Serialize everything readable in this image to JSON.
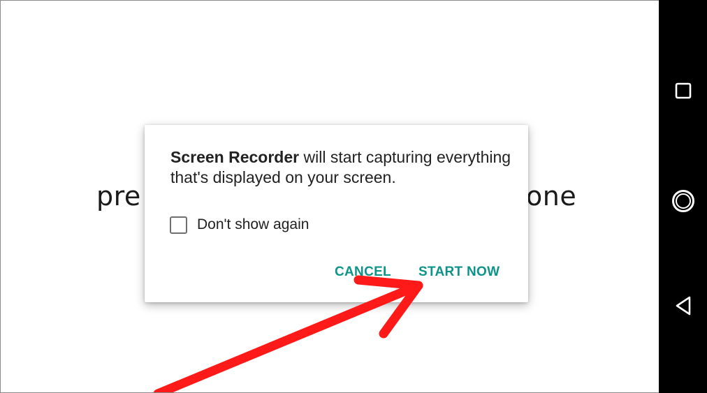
{
  "background": {
    "text_left": "pre",
    "text_right": "one"
  },
  "dialog": {
    "app_name": "Screen Recorder",
    "message_rest": " will start capturing everything that's displayed on your screen.",
    "checkbox_label": "Don't show again",
    "checkbox_checked": false,
    "cancel_label": "CANCEL",
    "start_label": "START NOW",
    "accent_color": "#0d9488"
  },
  "annotation": {
    "arrow_color": "#ff1a1a"
  },
  "navbar": {
    "recents_icon": "square-recents-icon",
    "home_icon": "circle-home-icon",
    "back_icon": "triangle-back-icon"
  }
}
